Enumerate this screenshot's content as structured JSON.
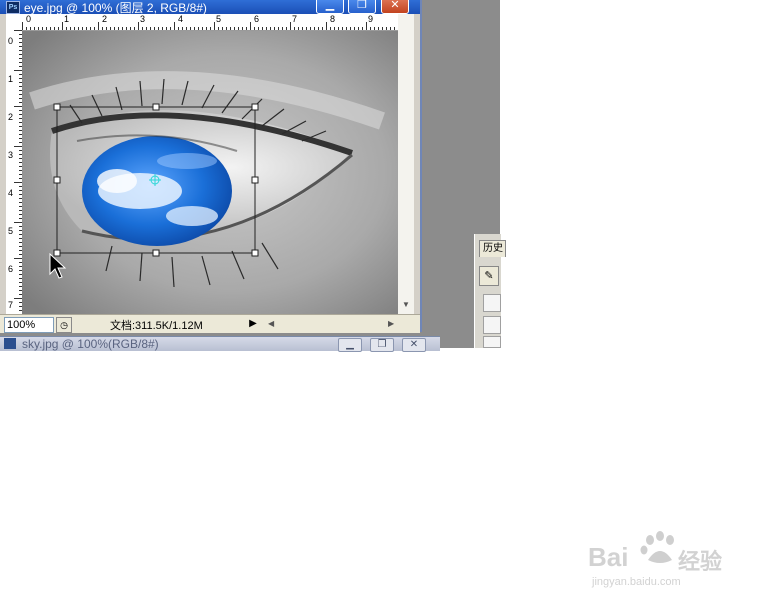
{
  "document": {
    "title": "eye.jpg @ 100% (图层 2, RGB/8#)",
    "zoom": "100%",
    "info": "文档:311.5K/1.12M"
  },
  "window_buttons": {
    "minimize": "▁",
    "restore": "❐",
    "close": "✕"
  },
  "rulers": {
    "top_labels": [
      "0",
      "1",
      "2",
      "3",
      "4",
      "5",
      "6",
      "7",
      "8",
      "9"
    ],
    "left_labels": [
      "0",
      "1",
      "2",
      "3",
      "4",
      "5",
      "6",
      "7"
    ]
  },
  "second_document": {
    "title": "sky.jpg @ 100%(RGB/8#)"
  },
  "palette": {
    "tab_label": "历史"
  },
  "watermark": {
    "brand": "Bai",
    "brand_suffix": "经验",
    "url": "jingyan.baidu.com"
  },
  "colors": {
    "titlebar": "#1b4fb6",
    "iris_blue": "#1a6fd8",
    "status_bg": "#ece9d8"
  }
}
